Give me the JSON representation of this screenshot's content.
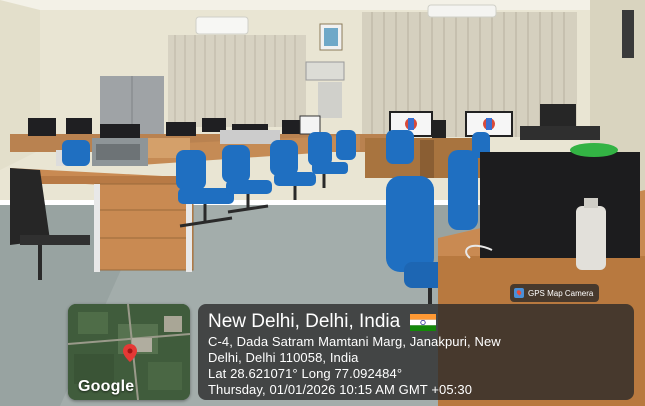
{
  "photo": {
    "subject": "computer lab with blue office chairs, desks and monitors"
  },
  "overlay": {
    "badge_label": "GPS Map Camera",
    "map_label": "Google",
    "city_title": "New Delhi, Delhi, India",
    "address_line1": "C-4, Dada Satram Mamtani Marg, Janakpuri, New",
    "address_line2": "Delhi, Delhi 110058, India",
    "coords": "Lat 28.621071° Long 77.092484°",
    "datetime": "Thursday, 01/01/2026 10:15 AM GMT +05:30"
  },
  "colors": {
    "chair_blue": "#1f6fc1",
    "wall": "#ece8d8",
    "floor": "#9aa6a3",
    "desk_wood": "#c98a52",
    "card_bg": "#282828"
  }
}
